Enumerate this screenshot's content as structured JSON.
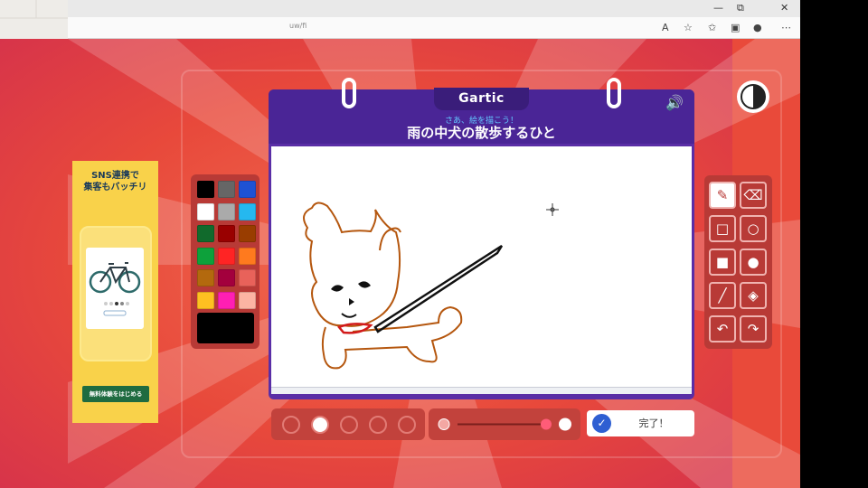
{
  "browser": {
    "window_controls": {
      "minimize": "—",
      "maximize": "⧉",
      "close": "✕"
    },
    "url_fragment": "uw/fi",
    "toolbar_icons": [
      "read-aloud-icon",
      "favorite-icon",
      "favorites-list-icon",
      "collections-icon",
      "profile-icon",
      "more-icon"
    ]
  },
  "ad": {
    "headline_line1": "SNS連携で",
    "headline_line2": "集客もバッチリ",
    "cta": "無料体験をはじめる"
  },
  "game": {
    "logo": "Gartic",
    "subtitle": "さあ、絵を描こう！",
    "word": "雨の中犬の散歩するひと",
    "done_label": "完了！"
  },
  "palette": {
    "colors": [
      "#000000",
      "#666666",
      "#1e52d4",
      "#ffffff",
      "#aaaaaa",
      "#25b8ef",
      "#116a2c",
      "#990000",
      "#993d00",
      "#0da13b",
      "#ff2424",
      "#ff7a1e",
      "#b3690e",
      "#a3003d",
      "#e8625a",
      "#fec021",
      "#ff1fb3",
      "#fcb4a3"
    ],
    "current_color": "#000000"
  },
  "tools": [
    "pencil-icon",
    "eraser-icon",
    "rectangle-outline-icon",
    "circle-outline-icon",
    "rectangle-fill-icon",
    "circle-fill-icon",
    "line-icon",
    "bucket-fill-icon",
    "undo-icon",
    "redo-icon"
  ],
  "brush_sizes": [
    "size-1",
    "size-2",
    "size-3",
    "size-4",
    "size-5"
  ],
  "colors": {
    "background": "#e94a3a",
    "board": "#5a2ea6",
    "panel": "#b83a36",
    "accent_blue": "#2e5fd2"
  }
}
